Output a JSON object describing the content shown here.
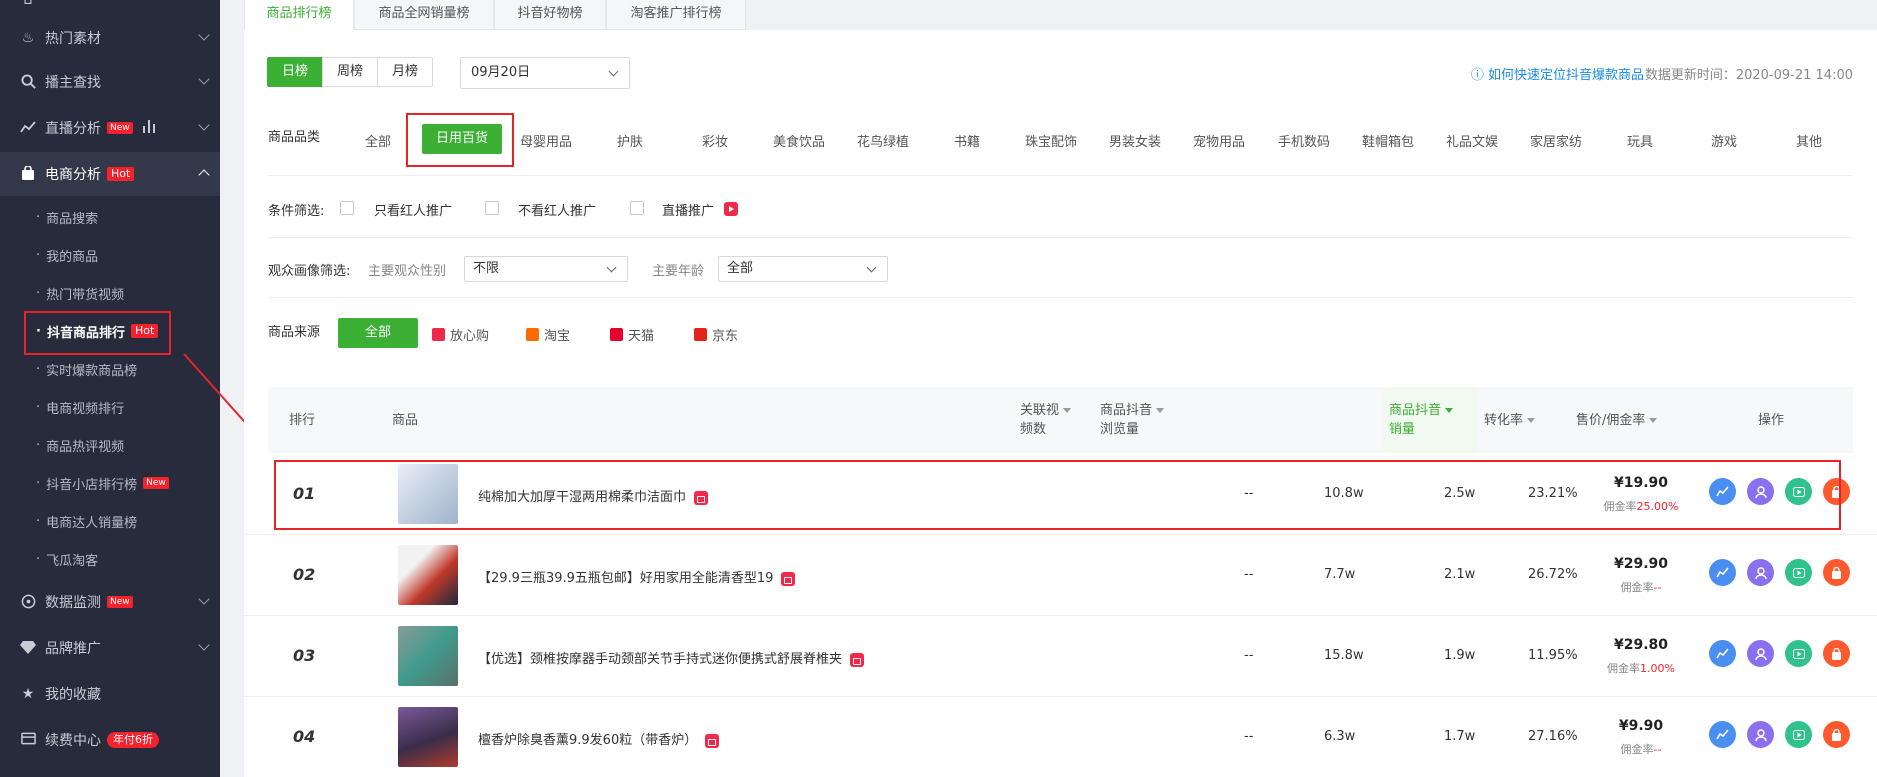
{
  "sidebar": {
    "items": [
      {
        "label": "热门素材",
        "icon": "fire-icon"
      },
      {
        "label": "播主查找",
        "icon": "search-icon"
      },
      {
        "label": "直播分析",
        "icon": "trend-icon",
        "badge": "New"
      },
      {
        "label": "电商分析",
        "icon": "bag-icon",
        "badge": "Hot"
      }
    ],
    "sub_items": [
      {
        "label": "商品搜索"
      },
      {
        "label": "我的商品"
      },
      {
        "label": "热门带货视频"
      },
      {
        "label": "抖音商品排行",
        "badge": "Hot"
      },
      {
        "label": "实时爆款商品榜"
      },
      {
        "label": "电商视频排行"
      },
      {
        "label": "商品热评视频"
      },
      {
        "label": "抖音小店排行榜",
        "badge": "New"
      },
      {
        "label": "电商达人销量榜"
      },
      {
        "label": "飞瓜淘客"
      }
    ],
    "bottom_items": [
      {
        "label": "数据监测",
        "icon": "monitor-icon",
        "badge": "New"
      },
      {
        "label": "品牌推广",
        "icon": "diamond-icon"
      },
      {
        "label": "我的收藏",
        "icon": "star-icon"
      },
      {
        "label": "续费中心",
        "icon": "card-icon",
        "badge": "年付6折"
      }
    ],
    "dot": "·"
  },
  "tabs": [
    "商品排行榜",
    "商品全网销量榜",
    "抖音好物榜",
    "淘客推广排行榜"
  ],
  "period": {
    "options": [
      "日榜",
      "周榜",
      "月榜"
    ],
    "selected": "日榜"
  },
  "date_select": "09月20日",
  "help_link": "如何快速定位抖音爆款商品",
  "update_time": "数据更新时间：2020-09-21 14:00",
  "category": {
    "label": "商品品类",
    "items": [
      "全部",
      "日用百货",
      "母婴用品",
      "护肤",
      "彩妆",
      "美食饮品",
      "花鸟绿植",
      "书籍",
      "珠宝配饰",
      "男装女装",
      "宠物用品",
      "手机数码",
      "鞋帽箱包",
      "礼品文娱",
      "家居家纺",
      "玩具",
      "游戏",
      "其他"
    ],
    "selected": "日用百货"
  },
  "filters": {
    "label": "条件筛选:",
    "options": [
      "只看红人推广",
      "不看红人推广",
      "直播推广"
    ]
  },
  "audience": {
    "label": "观众画像筛选:",
    "gender_label": "主要观众性别",
    "gender_value": "不限",
    "age_label": "主要年龄",
    "age_value": "全部"
  },
  "source": {
    "label": "商品来源",
    "all": "全部",
    "items": [
      {
        "label": "放心购",
        "color": "#f0284a"
      },
      {
        "label": "淘宝",
        "color": "#ff6a00"
      },
      {
        "label": "天猫",
        "color": "#e4002b"
      },
      {
        "label": "京东",
        "color": "#e1251b"
      }
    ]
  },
  "table": {
    "headers": {
      "rank": "排行",
      "product": "商品",
      "videos_1": "关联视",
      "videos_2": "频数",
      "views_1": "商品抖音",
      "views_2": "浏览量",
      "sales_1": "商品抖音",
      "sales_2": "销量",
      "conversion": "转化率",
      "price": "售价/佣金率",
      "ops": "操作"
    },
    "rows": [
      {
        "rank": "01",
        "name": "纯棉加大加厚干湿两用棉柔巾洁面巾",
        "videos": "--",
        "views": "10.8w",
        "sales": "2.5w",
        "conversion": "23.21%",
        "price": "¥19.90",
        "comm_label": "佣金率",
        "comm": "25.00%",
        "thumb": "#c9d6e6"
      },
      {
        "rank": "02",
        "name": "【29.9三瓶39.9五瓶包邮】好用家用全能清香型19",
        "videos": "--",
        "views": "7.7w",
        "sales": "2.1w",
        "conversion": "26.72%",
        "price": "¥29.90",
        "comm_label": "佣金率",
        "comm": "--",
        "thumb": "#b33a2e"
      },
      {
        "rank": "03",
        "name": "【优选】颈椎按摩器手动颈部关节手持式迷你便携式舒展脊椎夹",
        "videos": "--",
        "views": "15.8w",
        "sales": "1.9w",
        "conversion": "11.95%",
        "price": "¥29.80",
        "comm_label": "佣金率",
        "comm": "1.00%",
        "thumb": "#5a6f6b"
      },
      {
        "rank": "04",
        "name": "檀香炉除臭香薰9.9发60粒（带香炉）",
        "videos": "--",
        "views": "6.3w",
        "sales": "1.7w",
        "conversion": "27.16%",
        "price": "¥9.90",
        "comm_label": "佣金率",
        "comm": "--",
        "thumb": "#4a3d5c"
      }
    ]
  }
}
